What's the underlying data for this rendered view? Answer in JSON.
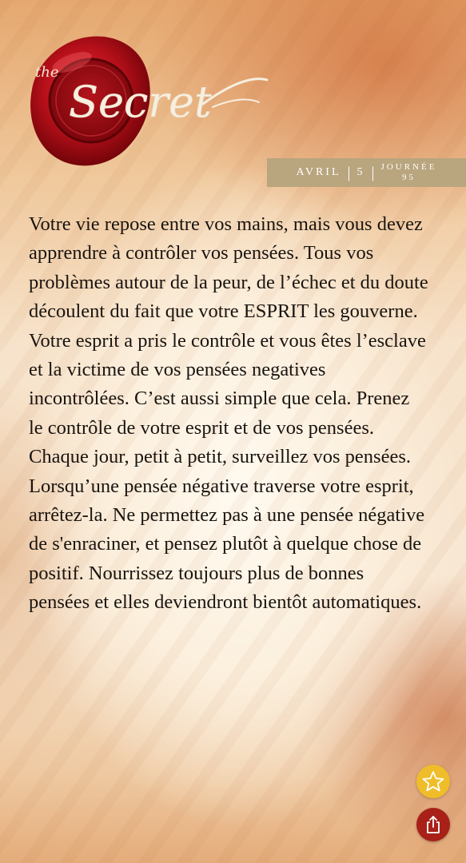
{
  "logo": {
    "the": "the",
    "brand": "Secret",
    "seal_color": "#c0141c"
  },
  "date": {
    "month": "AVRIL",
    "separator": "|",
    "day": "5",
    "journee_label": "JOURNÉE",
    "journee_number": "95"
  },
  "quote": {
    "paragraphs": [
      "Votre vie repose entre vos mains, mais vous devez apprendre à contrôler vos pensées. Tous vos problèmes autour de la peur, de l’échec et du doute découlent du fait que votre ESPRIT les gouverne.",
      "Votre esprit a pris le contrôle et vous êtes l’esclave et la victime de vos pensées negatives incontrôlées. C’est aussi simple que cela. Prenez le contrôle de votre esprit et de vos pensées. Chaque jour, petit à petit, surveillez vos pensées.",
      "Lorsqu’une pensée négative traverse votre esprit, arrêtez-la. Ne permettez pas à une pensée négative de s'enraciner, et pensez plutôt à quelque chose de positif. Nourrissez toujours plus de bonnes pensées et elles deviendront bientôt automatiques."
    ]
  },
  "actions": {
    "favorite_icon": "star-icon",
    "share_icon": "share-icon",
    "favorite_color": "#f0bd2a",
    "share_color": "#a82018"
  }
}
